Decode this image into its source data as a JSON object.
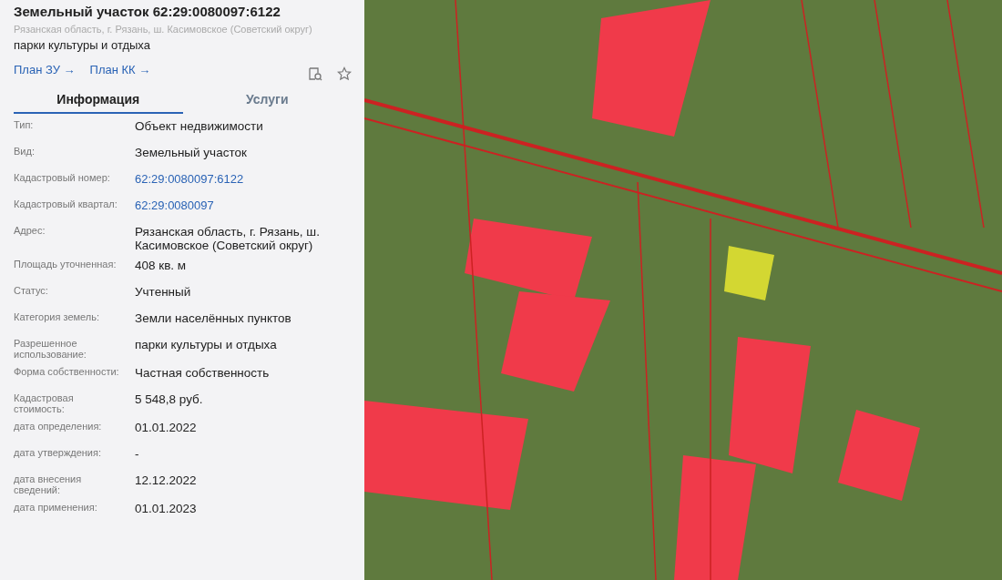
{
  "panel": {
    "title": "Земельный участок 62:29:0080097:6122",
    "address": "Рязанская область, г. Рязань, ш. Касимовское (Советский округ)",
    "usage": "парки культуры и отдыха",
    "links": [
      "План ЗУ →",
      "План КК →"
    ],
    "tabs": [
      {
        "label": "Информация",
        "selected": true
      },
      {
        "label": "Услуги",
        "selected": false
      }
    ],
    "rows": [
      {
        "label": "Тип:",
        "value": "Объект недвижимости",
        "kind": "text"
      },
      {
        "label": "Вид:",
        "value": "Земельный участок",
        "kind": "text"
      },
      {
        "label": "Кадастровый номер:",
        "value": "62:29:0080097:6122",
        "kind": "link"
      },
      {
        "label": "Кадастровый квартал:",
        "value": "62:29:0080097",
        "kind": "link"
      },
      {
        "label": "Адрес:",
        "value": "Рязанская область, г. Рязань, ш. Касимовское (Советский округ)",
        "kind": "text"
      },
      {
        "label": "Площадь уточненная:",
        "value": "408 кв. м",
        "kind": "text"
      },
      {
        "label": "Статус:",
        "value": "Учтенный",
        "kind": "text"
      },
      {
        "label": "Категория земель:",
        "value": "Земли населённых пунктов",
        "kind": "text"
      },
      {
        "label": "Разрешенное использование:",
        "value": "парки культуры и отдыха",
        "kind": "text"
      },
      {
        "label": "Форма собственности:",
        "value": "Частная собственность",
        "kind": "text"
      },
      {
        "label": "Кадастровая стоимость:",
        "value": "5 548,8 руб.",
        "kind": "text"
      },
      {
        "label": "дата определения:",
        "value": "01.01.2022",
        "kind": "text"
      },
      {
        "label": "дата утверждения:",
        "value": "-",
        "kind": "text"
      },
      {
        "label": "дата внесения сведений:",
        "value": "12.12.2022",
        "kind": "text"
      },
      {
        "label": "дата применения:",
        "value": "01.01.2023",
        "kind": "text"
      }
    ]
  }
}
